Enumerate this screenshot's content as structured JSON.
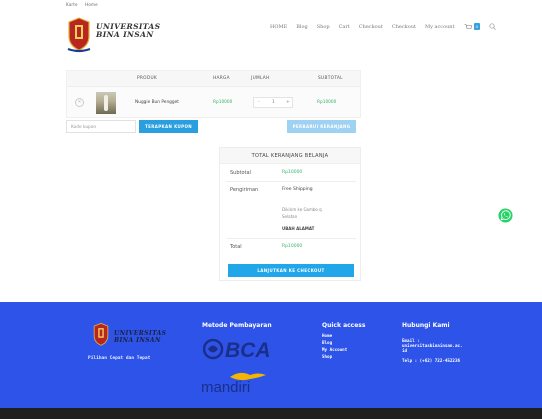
{
  "topbar": {
    "links": [
      "Karte",
      "Home"
    ]
  },
  "brand": {
    "line1": "UNIVERSITAS",
    "line2": "BINA INSAN"
  },
  "nav": {
    "items": [
      "HOME",
      "Blog",
      "Shop",
      "Cart",
      "Checkout",
      "Checkout",
      "My account"
    ],
    "cart_count": "0"
  },
  "cart_table": {
    "headers": {
      "product": "PRODUK",
      "price": "HARGA",
      "qty": "JUMLAH",
      "subtotal": "SUBTOTAL"
    },
    "row": {
      "remove": "×",
      "name": "Nuggie Bun Pengget",
      "price": "Rp10000",
      "qty": "1",
      "minus": "-",
      "plus": "+",
      "subtotal": "Rp10000"
    }
  },
  "coupon": {
    "placeholder": "Kode kupon",
    "apply_label": "TERAPKAN KUPON",
    "update_label": "PERBARUI KERANJANG"
  },
  "totals": {
    "title": "TOTAL KERANJANG BELANJA",
    "subtotal_label": "Subtotal",
    "subtotal_value": "Rp10000",
    "shipping_label": "Pengiriman",
    "shipping_value": "Free Shipping",
    "note_line1": "Dikirim ke Gambo q",
    "note_line2": "Selatan",
    "change_address": "UBAH ALAMAT",
    "total_label": "Total",
    "total_value": "Rp10000",
    "checkout_label": "LANJUTKAN KE CHECKOUT"
  },
  "footer": {
    "brand_line1": "UNIVERSITAS",
    "brand_line2": "BINA INSAN",
    "tagline": "Pilihan Cepat dan Tepat",
    "payment_heading": "Metode Pembayaran",
    "bca_label": "BCA",
    "mandiri_label": "mandiri",
    "quick_heading": "Quick access",
    "quick_links": [
      "Home",
      "Blog",
      "My Account",
      "Shop"
    ],
    "contact_heading": "Hubungi Kami",
    "email_line1": "Email :",
    "email_line2": "universitasbinainsan.ac.",
    "email_line3": "id",
    "phone": "Telp : (+62) 722-452236"
  },
  "colors": {
    "accent": "#2a9fe0",
    "footer_bg": "#2e53e8",
    "price_green": "#3ab26c",
    "whatsapp": "#25d366"
  }
}
